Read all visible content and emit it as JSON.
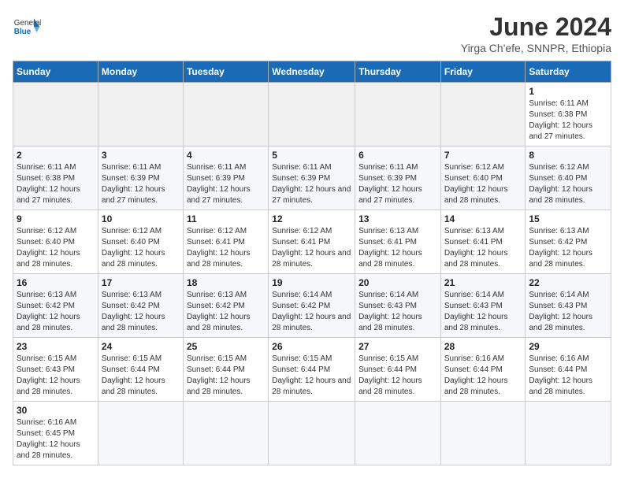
{
  "header": {
    "logo_general": "General",
    "logo_blue": "Blue",
    "month_title": "June 2024",
    "location": "Yirga Ch'efe, SNNPR, Ethiopia"
  },
  "days_of_week": [
    "Sunday",
    "Monday",
    "Tuesday",
    "Wednesday",
    "Thursday",
    "Friday",
    "Saturday"
  ],
  "weeks": [
    [
      {
        "day": "",
        "info": ""
      },
      {
        "day": "",
        "info": ""
      },
      {
        "day": "",
        "info": ""
      },
      {
        "day": "",
        "info": ""
      },
      {
        "day": "",
        "info": ""
      },
      {
        "day": "",
        "info": ""
      },
      {
        "day": "1",
        "info": "Sunrise: 6:11 AM\nSunset: 6:38 PM\nDaylight: 12 hours and 27 minutes."
      }
    ],
    [
      {
        "day": "2",
        "info": "Sunrise: 6:11 AM\nSunset: 6:38 PM\nDaylight: 12 hours and 27 minutes."
      },
      {
        "day": "3",
        "info": "Sunrise: 6:11 AM\nSunset: 6:39 PM\nDaylight: 12 hours and 27 minutes."
      },
      {
        "day": "4",
        "info": "Sunrise: 6:11 AM\nSunset: 6:39 PM\nDaylight: 12 hours and 27 minutes."
      },
      {
        "day": "5",
        "info": "Sunrise: 6:11 AM\nSunset: 6:39 PM\nDaylight: 12 hours and 27 minutes."
      },
      {
        "day": "6",
        "info": "Sunrise: 6:11 AM\nSunset: 6:39 PM\nDaylight: 12 hours and 27 minutes."
      },
      {
        "day": "7",
        "info": "Sunrise: 6:12 AM\nSunset: 6:40 PM\nDaylight: 12 hours and 28 minutes."
      },
      {
        "day": "8",
        "info": "Sunrise: 6:12 AM\nSunset: 6:40 PM\nDaylight: 12 hours and 28 minutes."
      }
    ],
    [
      {
        "day": "9",
        "info": "Sunrise: 6:12 AM\nSunset: 6:40 PM\nDaylight: 12 hours and 28 minutes."
      },
      {
        "day": "10",
        "info": "Sunrise: 6:12 AM\nSunset: 6:40 PM\nDaylight: 12 hours and 28 minutes."
      },
      {
        "day": "11",
        "info": "Sunrise: 6:12 AM\nSunset: 6:41 PM\nDaylight: 12 hours and 28 minutes."
      },
      {
        "day": "12",
        "info": "Sunrise: 6:12 AM\nSunset: 6:41 PM\nDaylight: 12 hours and 28 minutes."
      },
      {
        "day": "13",
        "info": "Sunrise: 6:13 AM\nSunset: 6:41 PM\nDaylight: 12 hours and 28 minutes."
      },
      {
        "day": "14",
        "info": "Sunrise: 6:13 AM\nSunset: 6:41 PM\nDaylight: 12 hours and 28 minutes."
      },
      {
        "day": "15",
        "info": "Sunrise: 6:13 AM\nSunset: 6:42 PM\nDaylight: 12 hours and 28 minutes."
      }
    ],
    [
      {
        "day": "16",
        "info": "Sunrise: 6:13 AM\nSunset: 6:42 PM\nDaylight: 12 hours and 28 minutes."
      },
      {
        "day": "17",
        "info": "Sunrise: 6:13 AM\nSunset: 6:42 PM\nDaylight: 12 hours and 28 minutes."
      },
      {
        "day": "18",
        "info": "Sunrise: 6:13 AM\nSunset: 6:42 PM\nDaylight: 12 hours and 28 minutes."
      },
      {
        "day": "19",
        "info": "Sunrise: 6:14 AM\nSunset: 6:42 PM\nDaylight: 12 hours and 28 minutes."
      },
      {
        "day": "20",
        "info": "Sunrise: 6:14 AM\nSunset: 6:43 PM\nDaylight: 12 hours and 28 minutes."
      },
      {
        "day": "21",
        "info": "Sunrise: 6:14 AM\nSunset: 6:43 PM\nDaylight: 12 hours and 28 minutes."
      },
      {
        "day": "22",
        "info": "Sunrise: 6:14 AM\nSunset: 6:43 PM\nDaylight: 12 hours and 28 minutes."
      }
    ],
    [
      {
        "day": "23",
        "info": "Sunrise: 6:15 AM\nSunset: 6:43 PM\nDaylight: 12 hours and 28 minutes."
      },
      {
        "day": "24",
        "info": "Sunrise: 6:15 AM\nSunset: 6:44 PM\nDaylight: 12 hours and 28 minutes."
      },
      {
        "day": "25",
        "info": "Sunrise: 6:15 AM\nSunset: 6:44 PM\nDaylight: 12 hours and 28 minutes."
      },
      {
        "day": "26",
        "info": "Sunrise: 6:15 AM\nSunset: 6:44 PM\nDaylight: 12 hours and 28 minutes."
      },
      {
        "day": "27",
        "info": "Sunrise: 6:15 AM\nSunset: 6:44 PM\nDaylight: 12 hours and 28 minutes."
      },
      {
        "day": "28",
        "info": "Sunrise: 6:16 AM\nSunset: 6:44 PM\nDaylight: 12 hours and 28 minutes."
      },
      {
        "day": "29",
        "info": "Sunrise: 6:16 AM\nSunset: 6:44 PM\nDaylight: 12 hours and 28 minutes."
      }
    ],
    [
      {
        "day": "30",
        "info": "Sunrise: 6:16 AM\nSunset: 6:45 PM\nDaylight: 12 hours and 28 minutes."
      },
      {
        "day": "",
        "info": ""
      },
      {
        "day": "",
        "info": ""
      },
      {
        "day": "",
        "info": ""
      },
      {
        "day": "",
        "info": ""
      },
      {
        "day": "",
        "info": ""
      },
      {
        "day": "",
        "info": ""
      }
    ]
  ]
}
